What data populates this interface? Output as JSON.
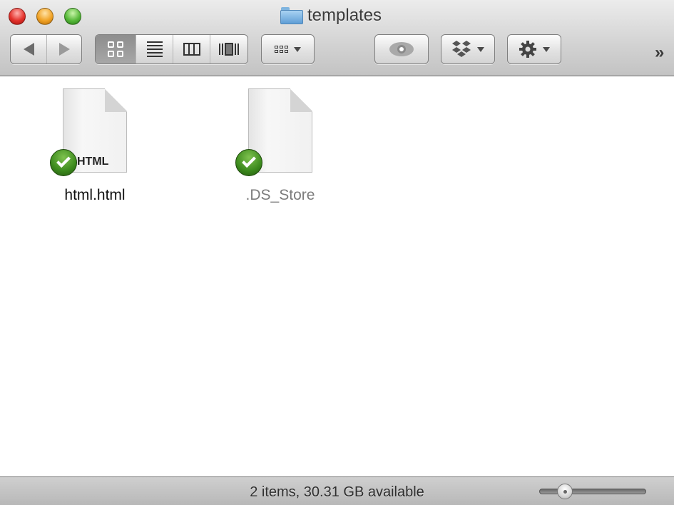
{
  "window": {
    "title": "templates",
    "title_icon": "folder-icon"
  },
  "toolbar": {
    "back_icon": "back-arrow-icon",
    "forward_icon": "forward-arrow-icon",
    "view_modes": [
      {
        "name": "icon-view",
        "icon": "icon-grid-icon",
        "active": true
      },
      {
        "name": "list-view",
        "icon": "list-icon",
        "active": false
      },
      {
        "name": "column-view",
        "icon": "columns-icon",
        "active": false
      },
      {
        "name": "coverflow-view",
        "icon": "coverflow-icon",
        "active": false
      }
    ],
    "arrange_icon": "arrange-grid-icon",
    "quicklook_icon": "eye-icon",
    "dropbox_icon": "dropbox-icon",
    "action_icon": "gear-icon",
    "overflow_label": "»"
  },
  "files": [
    {
      "name": "html.html",
      "badge": "HTML",
      "status_icon": "sync-check-icon",
      "hidden": false
    },
    {
      "name": ".DS_Store",
      "badge": "",
      "status_icon": "sync-check-icon",
      "hidden": true
    }
  ],
  "statusbar": {
    "text": "2 items, 30.31 GB available",
    "icon_size_slider_percent": 24
  }
}
